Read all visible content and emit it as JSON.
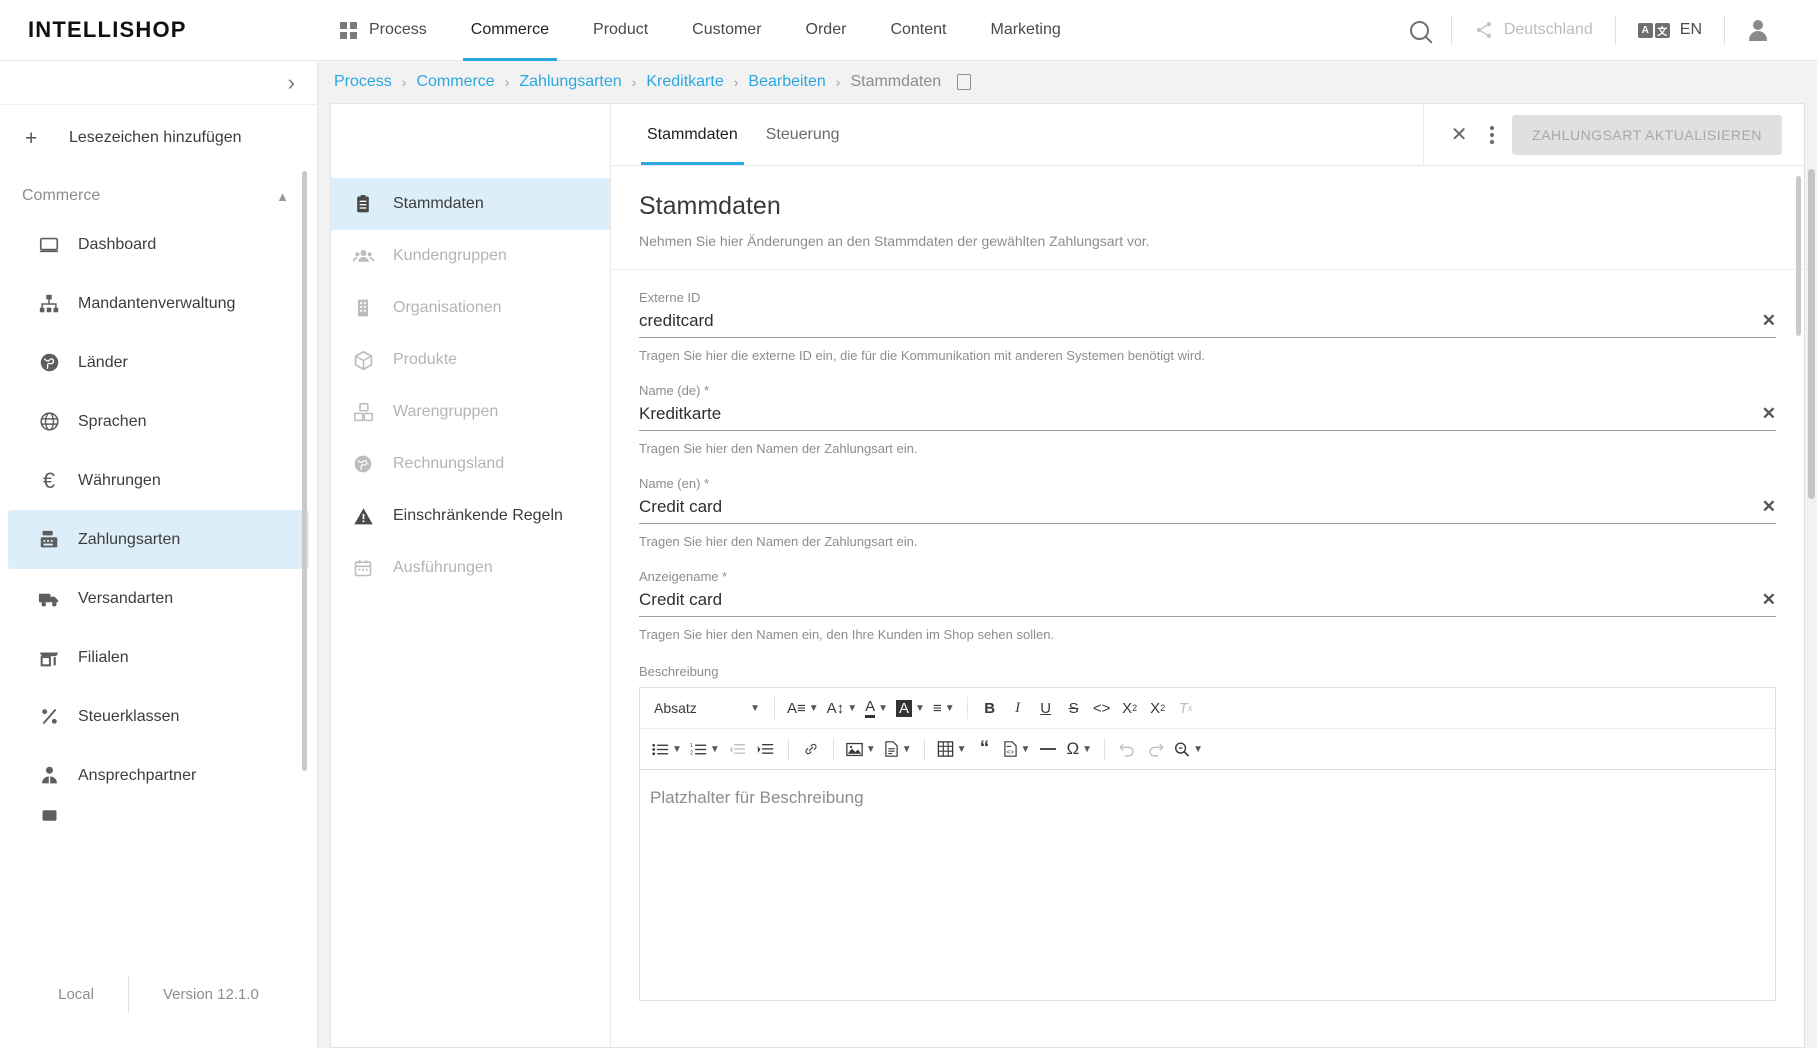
{
  "app": {
    "brand": "INTELLISHOP"
  },
  "topnav": {
    "grid_icon": "grid-icon",
    "items": [
      {
        "label": "Process",
        "active": false
      },
      {
        "label": "Commerce",
        "active": true
      },
      {
        "label": "Product",
        "active": false
      },
      {
        "label": "Customer",
        "active": false
      },
      {
        "label": "Order",
        "active": false
      },
      {
        "label": "Content",
        "active": false
      },
      {
        "label": "Marketing",
        "active": false
      }
    ],
    "right": {
      "search_icon": "search-icon",
      "share_icon": "share-icon",
      "country": "Deutschland",
      "translate_icon": "translate-icon",
      "language": "EN",
      "avatar_icon": "user-avatar-icon"
    }
  },
  "sidebar": {
    "collapse_icon": "chevron-right-icon",
    "bookmark": {
      "label": "Lesezeichen hinzufügen",
      "icon": "plus-icon"
    },
    "group": {
      "label": "Commerce",
      "chevron": "chevron-up-icon"
    },
    "items": [
      {
        "label": "Dashboard",
        "icon": "monitor-icon",
        "active": false
      },
      {
        "label": "Mandantenverwaltung",
        "icon": "sitemap-icon",
        "active": false
      },
      {
        "label": "Länder",
        "icon": "globe-filled-icon",
        "active": false
      },
      {
        "label": "Sprachen",
        "icon": "globe-wire-icon",
        "active": false
      },
      {
        "label": "Währungen",
        "icon": "euro-icon",
        "active": false
      },
      {
        "label": "Zahlungsarten",
        "icon": "cash-register-icon",
        "active": true
      },
      {
        "label": "Versandarten",
        "icon": "truck-icon",
        "active": false
      },
      {
        "label": "Filialen",
        "icon": "store-icon",
        "active": false
      },
      {
        "label": "Steuerklassen",
        "icon": "percent-icon",
        "active": false
      },
      {
        "label": "Ansprechpartner",
        "icon": "contact-person-icon",
        "active": false
      }
    ],
    "footer": {
      "environment": "Local",
      "version": "Version 12.1.0"
    }
  },
  "breadcrumb": {
    "items": [
      {
        "label": "Process",
        "link": true
      },
      {
        "label": "Commerce",
        "link": true
      },
      {
        "label": "Zahlungsarten",
        "link": true
      },
      {
        "label": "Kreditkarte",
        "link": true
      },
      {
        "label": "Bearbeiten",
        "link": true
      },
      {
        "label": "Stammdaten",
        "link": false
      }
    ],
    "separator": "›",
    "copy_icon": "copy-icon"
  },
  "subnav": {
    "items": [
      {
        "label": "Stammdaten",
        "icon": "clipboard-icon",
        "active": true,
        "enabled": true
      },
      {
        "label": "Kundengruppen",
        "icon": "users-icon",
        "active": false,
        "enabled": false
      },
      {
        "label": "Organisationen",
        "icon": "building-icon",
        "active": false,
        "enabled": false
      },
      {
        "label": "Produkte",
        "icon": "box-icon",
        "active": false,
        "enabled": false
      },
      {
        "label": "Warengruppen",
        "icon": "boxes-icon",
        "active": false,
        "enabled": false
      },
      {
        "label": "Rechnungsland",
        "icon": "globe-filled-icon",
        "active": false,
        "enabled": false
      },
      {
        "label": "Einschränkende Regeln",
        "icon": "warning-triangle-icon",
        "active": false,
        "enabled": true
      },
      {
        "label": "Ausführungen",
        "icon": "calendar-icon",
        "active": false,
        "enabled": false
      }
    ]
  },
  "tabs": {
    "items": [
      {
        "label": "Stammdaten",
        "active": true
      },
      {
        "label": "Steuerung",
        "active": false
      }
    ],
    "close_icon": "close-icon",
    "more_icon": "kebab-menu-icon",
    "update_button": "ZAHLUNGSART AKTUALISIEREN"
  },
  "section": {
    "title": "Stammdaten",
    "subtitle": "Nehmen Sie hier Änderungen an den Stammdaten der gewählten Zahlungsart vor."
  },
  "form": {
    "fields": [
      {
        "label": "Externe ID",
        "value": "creditcard",
        "placeholder": "",
        "help": "Tragen Sie hier die externe ID ein, die für die Kommunikation mit anderen Systemen benötigt wird.",
        "clear_icon": "clear-icon"
      },
      {
        "label": "Name (de) *",
        "value": "Kreditkarte",
        "placeholder": "",
        "help": "Tragen Sie hier den Namen der Zahlungsart ein.",
        "clear_icon": "clear-icon"
      },
      {
        "label": "Name (en) *",
        "value": "Credit card",
        "placeholder": "",
        "help": "Tragen Sie hier den Namen der Zahlungsart ein.",
        "clear_icon": "clear-icon"
      },
      {
        "label": "Anzeigename *",
        "value": "Credit card",
        "placeholder": "",
        "help": "Tragen Sie hier den Namen ein, den Ihre Kunden im Shop sehen sollen.",
        "clear_icon": "clear-icon"
      }
    ]
  },
  "editor": {
    "label": "Beschreibung",
    "paragraph_select": "Absatz",
    "placeholder": "Platzhalter für Beschreibung",
    "toolbar_row1": [
      {
        "name": "font-family-icon",
        "glyph": "A≡",
        "caret": true
      },
      {
        "name": "font-size-icon",
        "glyph": "A↕",
        "caret": true
      },
      {
        "name": "text-color-icon",
        "glyph": "A",
        "caret": true
      },
      {
        "name": "highlight-color-icon",
        "glyph": "A",
        "caret": true
      },
      {
        "name": "align-icon",
        "glyph": "≡",
        "caret": true
      },
      {
        "name": "bold-icon",
        "glyph": "B",
        "caret": false
      },
      {
        "name": "italic-icon",
        "glyph": "I",
        "caret": false
      },
      {
        "name": "underline-icon",
        "glyph": "U",
        "caret": false
      },
      {
        "name": "strikethrough-icon",
        "glyph": "S",
        "caret": false
      },
      {
        "name": "source-code-icon",
        "glyph": "<>",
        "caret": false
      },
      {
        "name": "subscript-icon",
        "glyph": "X",
        "caret": false
      },
      {
        "name": "superscript-icon",
        "glyph": "X",
        "caret": false
      },
      {
        "name": "clear-format-icon",
        "glyph": "T",
        "caret": false
      }
    ],
    "toolbar_row2": [
      {
        "name": "bullet-list-icon",
        "caret": true
      },
      {
        "name": "numbered-list-icon",
        "caret": true
      },
      {
        "name": "outdent-icon",
        "caret": false
      },
      {
        "name": "indent-icon",
        "caret": false
      },
      {
        "name": "link-icon",
        "caret": false
      },
      {
        "name": "image-icon",
        "caret": true
      },
      {
        "name": "document-icon",
        "caret": true
      },
      {
        "name": "table-icon",
        "caret": true
      },
      {
        "name": "blockquote-icon",
        "caret": false
      },
      {
        "name": "code-block-icon",
        "caret": true
      },
      {
        "name": "horizontal-rule-icon",
        "caret": false
      },
      {
        "name": "special-character-icon",
        "caret": true
      },
      {
        "name": "undo-icon",
        "caret": false
      },
      {
        "name": "redo-icon",
        "caret": false
      },
      {
        "name": "find-replace-icon",
        "caret": true
      }
    ]
  },
  "colors": {
    "accent": "#2ca8e0",
    "selected_bg": "#dceefa",
    "page_bg": "#f2f2f2",
    "muted_text": "#8d8d8d"
  }
}
